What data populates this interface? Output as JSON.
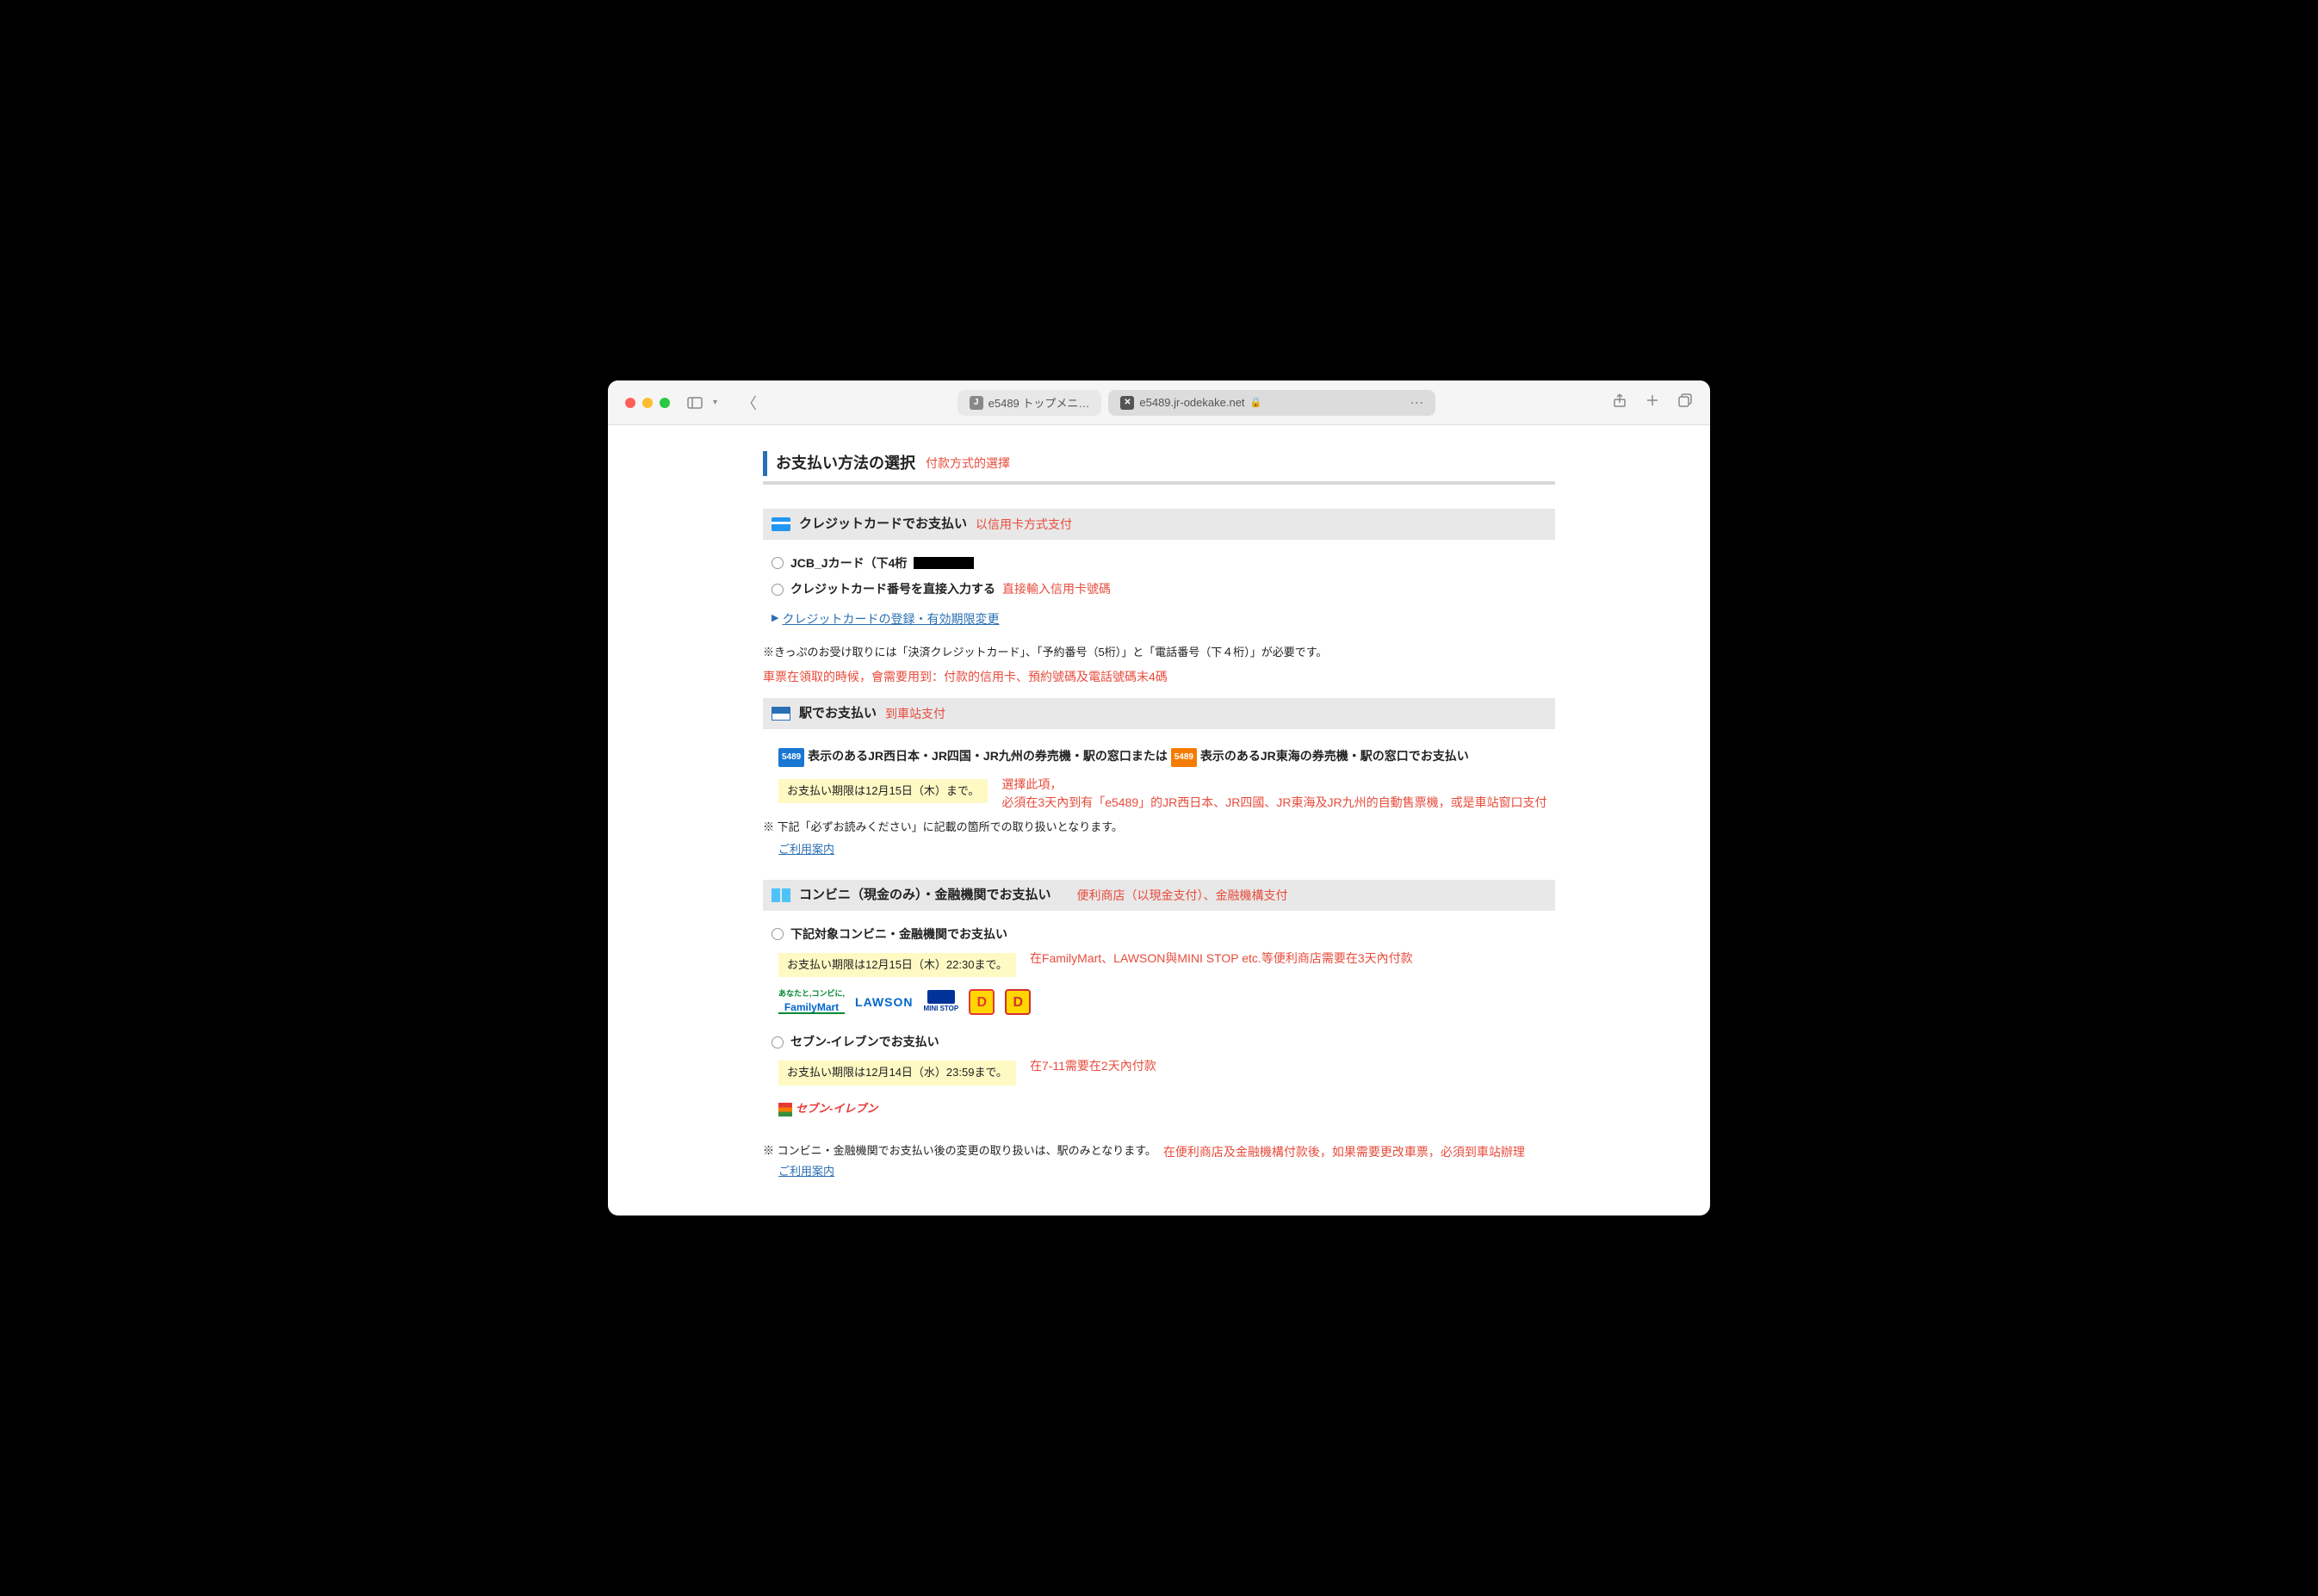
{
  "browser": {
    "tab1_label": "e5489 トップメニ…",
    "tab2_label": "e5489.jr-odekake.net"
  },
  "page": {
    "title": "お支払い方法の選択",
    "title_annotation": "付款方式的選擇"
  },
  "credit_card": {
    "header": "クレジットカードでお支払い",
    "header_annotation": "以信用卡方式支付",
    "option1_prefix": "JCB_Jカード（下4桁",
    "option2": "クレジットカード番号を直接入力する",
    "option2_annotation": "直接輸入信用卡號碼",
    "link": "クレジットカードの登録・有効期限変更",
    "note": "※きっぷのお受け取りには「決済クレジットカード」、「予約番号（5桁）」と「電話番号（下４桁）」が必要です。",
    "note_annotation": "車票在領取的時候，會需要用到：付款的信用卡、預約號碼及電話號碼末4碼"
  },
  "station": {
    "header": "駅でお支払い",
    "header_annotation": "到車站支付",
    "badge1": "5489",
    "text1": "表示のあるJR西日本・JR四国・JR九州の券売機・駅の窓口または",
    "badge2": "5489",
    "text2": "表示のあるJR東海の券売機・駅の窓口でお支払い",
    "deadline": "お支払い期限は12月15日（木）まで。",
    "annotation1": "選擇此項，",
    "annotation2": "必須在3天內到有「e5489」的JR西日本、JR四國、JR東海及JR九州的自動售票機，或是車站窗口支付",
    "note": "※ 下記「必ずお読みください」に記載の箇所での取り扱いとなります。",
    "guide_link": "ご利用案内"
  },
  "convenience": {
    "header": "コンビニ（現金のみ）・金融機関でお支払い",
    "header_annotation": "便利商店（以現金支付）、金融機構支付",
    "option1": "下記対象コンビニ・金融機関でお支払い",
    "deadline1": "お支払い期限は12月15日（木）22:30まで。",
    "annotation1": "在FamilyMart、LAWSON與MINI STOP etc.等便利商店需要在3天內付款",
    "option2": "セブン-イレブンでお支払い",
    "deadline2": "お支払い期限は12月14日（水）23:59まで。",
    "annotation2": "在7-11需要在2天內付款",
    "seven_logo": "セブン-イレブン",
    "note": "※ コンビニ・金融機関でお支払い後の変更の取り扱いは、駅のみとなります。",
    "note_annotation": "在便利商店及金融機構付款後，如果需要更改車票，必須到車站辦理",
    "guide_link": "ご利用案内",
    "logos": {
      "fm_top": "あなたと,コンビに,",
      "fm": "FamilyMart",
      "lawson": "LAWSON",
      "ministop": "MINI STOP"
    }
  }
}
